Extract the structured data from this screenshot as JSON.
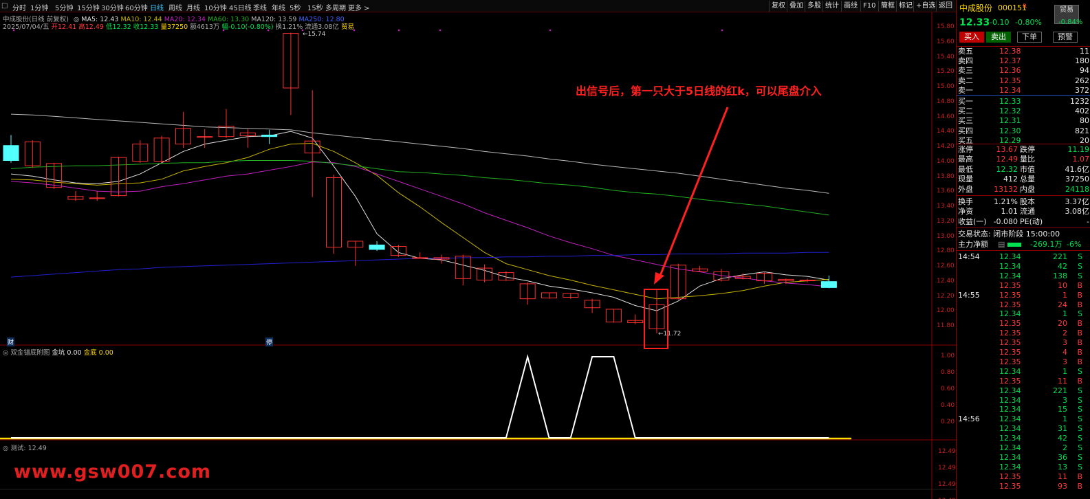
{
  "toolbar": {
    "tabs": [
      "分时",
      "1分钟",
      "5分钟",
      "15分钟",
      "30分钟",
      "60分钟",
      "日线",
      "周线",
      "月线",
      "10分钟",
      "45日线",
      "季线",
      "年线",
      "5秒",
      "15秒",
      "多周期",
      "更多 >"
    ],
    "active_tab": "日线",
    "right_buttons": [
      "复权",
      "叠加",
      "多股",
      "统计",
      "画线",
      "F10",
      "标记",
      "+自选",
      "返回"
    ]
  },
  "chart_header": {
    "title": "中成股份(日线 前复权)",
    "ma5": "MA5: 12.43",
    "ma10": "MA10: 12.44",
    "ma20": "MA20: 12.34",
    "ma60": "MA60: 13.30",
    "ma120": "MA120: 13.59",
    "ma250": "MA250: 12.80",
    "date": "2025/07/04/五",
    "open": "开12.41",
    "high": "高12.49",
    "low": "低12.32",
    "close": "收12.33",
    "vol": "量37250",
    "amount": "额4613万",
    "change": "幅-0.10(-0.80%)",
    "turnover": "换1.21%",
    "float": "流通3.08亿",
    "tag": "贸易"
  },
  "annotation": {
    "text": "出信号后，第一只大于5日线的红k，可以尾盘介入",
    "high_label": "15.74",
    "low_label": "11.72"
  },
  "markers": {
    "cai": "财",
    "ting": "停"
  },
  "price_axis": [
    "15.80",
    "15.60",
    "15.40",
    "15.20",
    "15.00",
    "14.80",
    "14.60",
    "14.40",
    "14.20",
    "14.00",
    "13.80",
    "13.60",
    "13.40",
    "13.20",
    "13.00",
    "12.80",
    "12.60",
    "12.40",
    "12.20",
    "12.00",
    "11.80"
  ],
  "indicator1": {
    "name": "双金锚底附图",
    "k1": "金坑",
    "v1": "0.00",
    "k2": "金底",
    "v2": "0.00",
    "axis": [
      "1.00",
      "0.80",
      "0.60",
      "0.40",
      "0.20"
    ]
  },
  "indicator2": {
    "name": "测试",
    "value": ": 12.49",
    "axis": [
      "12.49",
      "12.49",
      "12.49",
      "12.49"
    ]
  },
  "watermark": "www.gsw007.com",
  "quote": {
    "name": "中成股份",
    "code": "000151",
    "flag": "R",
    "mode": "贸易",
    "price": "12.33",
    "change": "-0.10",
    "pct": "-0.80%",
    "pct2": "-0.84%",
    "buttons": [
      "买入",
      "卖出",
      "下单",
      "预警"
    ],
    "asks": [
      {
        "label": "卖五",
        "price": "12.38",
        "vol": "11"
      },
      {
        "label": "卖四",
        "price": "12.37",
        "vol": "180"
      },
      {
        "label": "卖三",
        "price": "12.36",
        "vol": "94"
      },
      {
        "label": "卖二",
        "price": "12.35",
        "vol": "262"
      },
      {
        "label": "卖一",
        "price": "12.34",
        "vol": "372"
      }
    ],
    "bids": [
      {
        "label": "买一",
        "price": "12.33",
        "vol": "1232"
      },
      {
        "label": "买二",
        "price": "12.32",
        "vol": "402"
      },
      {
        "label": "买三",
        "price": "12.31",
        "vol": "80"
      },
      {
        "label": "买四",
        "price": "12.30",
        "vol": "821"
      },
      {
        "label": "买五",
        "price": "12.29",
        "vol": "20"
      }
    ],
    "stats": [
      {
        "k1": "涨停",
        "v1": "13.67",
        "k2": "跌停",
        "v2": "11.19",
        "c1": "red",
        "c2": "grn"
      },
      {
        "k1": "最高",
        "v1": "12.49",
        "k2": "量比",
        "v2": "1.07",
        "c1": "red",
        "c2": "red"
      },
      {
        "k1": "最低",
        "v1": "12.32",
        "k2": "市值",
        "v2": "41.6亿",
        "c1": "grn",
        "c2": "wht"
      },
      {
        "k1": "现量",
        "v1": "412",
        "k2": "总量",
        "v2": "37250",
        "c1": "wht",
        "c2": "wht"
      },
      {
        "k1": "外盘",
        "v1": "13132",
        "k2": "内盘",
        "v2": "24118",
        "c1": "red",
        "c2": "grn"
      }
    ],
    "stats2": [
      {
        "k1": "换手",
        "v1": "1.21%",
        "k2": "股本",
        "v2": "3.37亿"
      },
      {
        "k1": "净资",
        "v1": "1.01",
        "k2": "流通",
        "v2": "3.08亿"
      },
      {
        "k1": "收益(一)",
        "v1": "-0.080",
        "k2": "PE(动)",
        "v2": "-"
      }
    ],
    "trade_state": "交易状态: 闭市阶段 15:00:00",
    "main_flow": {
      "label": "主力净额",
      "value": "-269.1万",
      "pct": "-6%"
    },
    "ticks": [
      {
        "t": "14:54",
        "p": "12.34",
        "v": "221",
        "s": "S"
      },
      {
        "t": "",
        "p": "12.34",
        "v": "42",
        "s": "S"
      },
      {
        "t": "",
        "p": "12.34",
        "v": "138",
        "s": "S"
      },
      {
        "t": "",
        "p": "12.35",
        "v": "10",
        "s": "B"
      },
      {
        "t": "14:55",
        "p": "12.35",
        "v": "1",
        "s": "B"
      },
      {
        "t": "",
        "p": "12.35",
        "v": "24",
        "s": "B"
      },
      {
        "t": "",
        "p": "12.34",
        "v": "1",
        "s": "S"
      },
      {
        "t": "",
        "p": "12.35",
        "v": "20",
        "s": "B"
      },
      {
        "t": "",
        "p": "12.35",
        "v": "2",
        "s": "B"
      },
      {
        "t": "",
        "p": "12.35",
        "v": "3",
        "s": "B"
      },
      {
        "t": "",
        "p": "12.35",
        "v": "4",
        "s": "B"
      },
      {
        "t": "",
        "p": "12.35",
        "v": "3",
        "s": "B"
      },
      {
        "t": "",
        "p": "12.34",
        "v": "1",
        "s": "S"
      },
      {
        "t": "",
        "p": "12.35",
        "v": "11",
        "s": "B"
      },
      {
        "t": "",
        "p": "12.34",
        "v": "221",
        "s": "S"
      },
      {
        "t": "",
        "p": "12.34",
        "v": "3",
        "s": "S"
      },
      {
        "t": "",
        "p": "12.34",
        "v": "15",
        "s": "S"
      },
      {
        "t": "14:56",
        "p": "12.34",
        "v": "1",
        "s": "S"
      },
      {
        "t": "",
        "p": "12.34",
        "v": "31",
        "s": "S"
      },
      {
        "t": "",
        "p": "12.34",
        "v": "42",
        "s": "S"
      },
      {
        "t": "",
        "p": "12.34",
        "v": "2",
        "s": "S"
      },
      {
        "t": "",
        "p": "12.34",
        "v": "36",
        "s": "S"
      },
      {
        "t": "",
        "p": "12.34",
        "v": "13",
        "s": "S"
      },
      {
        "t": "",
        "p": "12.35",
        "v": "11",
        "s": "B"
      },
      {
        "t": "",
        "p": "12.35",
        "v": "93",
        "s": "B"
      }
    ]
  },
  "candles": [
    {
      "o": 14.23,
      "c": 14.03,
      "h": 14.37,
      "l": 14.0
    },
    {
      "o": 13.96,
      "c": 14.28,
      "h": 14.3,
      "l": 13.93
    },
    {
      "o": 13.67,
      "c": 13.99,
      "h": 14.0,
      "l": 13.65
    },
    {
      "o": 13.51,
      "c": 13.55,
      "h": 13.62,
      "l": 13.49
    },
    {
      "o": 13.52,
      "c": 13.53,
      "h": 13.62,
      "l": 13.49
    },
    {
      "o": 13.56,
      "c": 14.07,
      "h": 14.08,
      "l": 13.55
    },
    {
      "o": 14.02,
      "c": 14.25,
      "h": 14.3,
      "l": 14.0
    },
    {
      "o": 14.02,
      "c": 14.33,
      "h": 14.36,
      "l": 14.0
    },
    {
      "o": 14.25,
      "c": 14.46,
      "h": 14.68,
      "l": 14.2
    },
    {
      "o": 14.35,
      "c": 14.35,
      "h": 14.45,
      "l": 14.2
    },
    {
      "o": 14.35,
      "c": 14.49,
      "h": 14.72,
      "l": 14.33
    },
    {
      "o": 14.36,
      "c": 14.4,
      "h": 14.45,
      "l": 14.2
    },
    {
      "o": 14.37,
      "c": 14.35,
      "h": 14.44,
      "l": 14.25
    },
    {
      "o": 15.0,
      "c": 15.73,
      "h": 15.74,
      "l": 14.64
    },
    {
      "o": 14.13,
      "c": 14.29,
      "h": 14.97,
      "l": 13.54
    },
    {
      "o": 12.87,
      "c": 13.8,
      "h": 13.84,
      "l": 12.78
    },
    {
      "o": 12.87,
      "c": 12.95,
      "h": 12.95,
      "l": 12.62
    },
    {
      "o": 12.9,
      "c": 12.84,
      "h": 12.95,
      "l": 12.82
    },
    {
      "o": 12.76,
      "c": 12.88,
      "h": 12.9,
      "l": 12.74
    },
    {
      "o": 12.73,
      "c": 12.73,
      "h": 12.8,
      "l": 12.73
    },
    {
      "o": 12.71,
      "c": 12.73,
      "h": 12.77,
      "l": 12.65
    },
    {
      "o": 12.45,
      "c": 12.75,
      "h": 12.77,
      "l": 12.36
    },
    {
      "o": 12.43,
      "c": 12.59,
      "h": 12.64,
      "l": 12.4
    },
    {
      "o": 12.43,
      "c": 12.53,
      "h": 12.55,
      "l": 12.42
    },
    {
      "o": 12.18,
      "c": 12.38,
      "h": 12.4,
      "l": 12.1
    },
    {
      "o": 12.19,
      "c": 12.26,
      "h": 12.26,
      "l": 12.18
    },
    {
      "o": 12.2,
      "c": 12.25,
      "h": 12.25,
      "l": 12.18
    },
    {
      "o": 12.06,
      "c": 12.16,
      "h": 12.18,
      "l": 11.99
    },
    {
      "o": 11.87,
      "c": 12.04,
      "h": 12.04,
      "l": 11.86
    },
    {
      "o": 11.86,
      "c": 11.89,
      "h": 11.97,
      "l": 11.84
    },
    {
      "o": 11.78,
      "c": 12.1,
      "h": 12.3,
      "l": 11.72
    },
    {
      "o": 12.18,
      "c": 12.63,
      "h": 12.65,
      "l": 12.17
    },
    {
      "o": 12.55,
      "c": 12.58,
      "h": 12.62,
      "l": 12.55
    },
    {
      "o": 12.43,
      "c": 12.54,
      "h": 12.58,
      "l": 12.41
    },
    {
      "o": 12.45,
      "c": 12.48,
      "h": 12.52,
      "l": 12.44
    },
    {
      "o": 12.42,
      "c": 12.52,
      "h": 12.54,
      "l": 12.38
    },
    {
      "o": 12.42,
      "c": 12.44,
      "h": 12.45,
      "l": 12.38
    },
    {
      "o": 12.43,
      "c": 12.43,
      "h": 12.45,
      "l": 12.4
    },
    {
      "o": 12.41,
      "c": 12.33,
      "h": 12.49,
      "l": 12.32
    }
  ],
  "ma_lines": [
    {
      "name": "MA5",
      "color": "#e0e0e0",
      "v": [
        13.85,
        13.82,
        13.77,
        13.73,
        13.72,
        13.75,
        13.85,
        14.0,
        14.15,
        14.25,
        14.3,
        14.35,
        14.36,
        14.42,
        14.33,
        13.95,
        13.55,
        13.05,
        12.8,
        12.72,
        12.7,
        12.63,
        12.56,
        12.47,
        12.42,
        12.35,
        12.31,
        12.26,
        12.2,
        12.09,
        12.02,
        12.15,
        12.35,
        12.45,
        12.5,
        12.54,
        12.5,
        12.48,
        12.43
      ]
    },
    {
      "name": "MA10",
      "color": "#c8b400",
      "v": [
        13.78,
        13.77,
        13.74,
        13.72,
        13.7,
        13.72,
        13.73,
        13.78,
        13.89,
        13.95,
        14.0,
        14.07,
        14.18,
        14.25,
        14.26,
        14.15,
        14.0,
        13.83,
        13.6,
        13.41,
        13.2,
        13.0,
        12.8,
        12.65,
        12.57,
        12.49,
        12.43,
        12.36,
        12.3,
        12.24,
        12.18,
        12.2,
        12.22,
        12.25,
        12.29,
        12.35,
        12.4,
        12.42,
        12.44
      ]
    },
    {
      "name": "MA20",
      "color": "#c020c0",
      "v": [
        13.75,
        13.73,
        13.7,
        13.66,
        13.62,
        13.61,
        13.62,
        13.68,
        13.72,
        13.77,
        13.82,
        13.85,
        13.9,
        13.95,
        14.01,
        14.0,
        13.95,
        13.85,
        13.75,
        13.65,
        13.55,
        13.45,
        13.33,
        13.23,
        13.13,
        13.02,
        12.93,
        12.85,
        12.76,
        12.7,
        12.64,
        12.58,
        12.54,
        12.49,
        12.46,
        12.42,
        12.39,
        12.37,
        12.34
      ]
    },
    {
      "name": "MA60",
      "color": "#20b020",
      "v": [
        13.92,
        13.94,
        13.95,
        13.96,
        13.96,
        13.97,
        13.98,
        13.99,
        14.0,
        14.0,
        14.02,
        14.03,
        14.03,
        14.03,
        14.02,
        13.99,
        13.96,
        13.92,
        13.88,
        13.87,
        13.85,
        13.83,
        13.8,
        13.78,
        13.75,
        13.72,
        13.7,
        13.67,
        13.63,
        13.6,
        13.58,
        13.55,
        13.51,
        13.48,
        13.45,
        13.42,
        13.38,
        13.34,
        13.3
      ]
    },
    {
      "name": "MA120",
      "color": "#b8b8b8",
      "v": [
        14.65,
        14.64,
        14.62,
        14.6,
        14.58,
        14.56,
        14.54,
        14.52,
        14.5,
        14.48,
        14.47,
        14.46,
        14.45,
        14.44,
        14.4,
        14.37,
        14.34,
        14.31,
        14.28,
        14.25,
        14.22,
        14.19,
        14.15,
        14.12,
        14.09,
        14.05,
        14.02,
        13.98,
        13.95,
        13.92,
        13.89,
        13.86,
        13.82,
        13.78,
        13.74,
        13.7,
        13.66,
        13.63,
        13.59
      ]
    },
    {
      "name": "MA250",
      "color": "#2020d0",
      "v": [
        12.47,
        12.49,
        12.51,
        12.53,
        12.55,
        12.57,
        12.58,
        12.6,
        12.61,
        12.62,
        12.63,
        12.64,
        12.65,
        12.66,
        12.67,
        12.68,
        12.69,
        12.7,
        12.71,
        12.72,
        12.72,
        12.73,
        12.73,
        12.74,
        12.74,
        12.75,
        12.75,
        12.76,
        12.76,
        12.77,
        12.77,
        12.78,
        12.78,
        12.78,
        12.79,
        12.79,
        12.79,
        12.8,
        12.8
      ]
    }
  ],
  "signal": [
    0,
    0,
    0,
    0,
    0,
    0,
    0,
    0,
    0,
    0,
    0,
    0,
    0,
    0,
    0,
    0,
    0,
    0,
    0,
    0,
    0,
    0,
    0,
    0,
    1,
    0,
    0,
    1,
    1,
    0,
    0,
    0,
    0,
    0,
    0,
    0,
    0,
    0,
    0
  ]
}
